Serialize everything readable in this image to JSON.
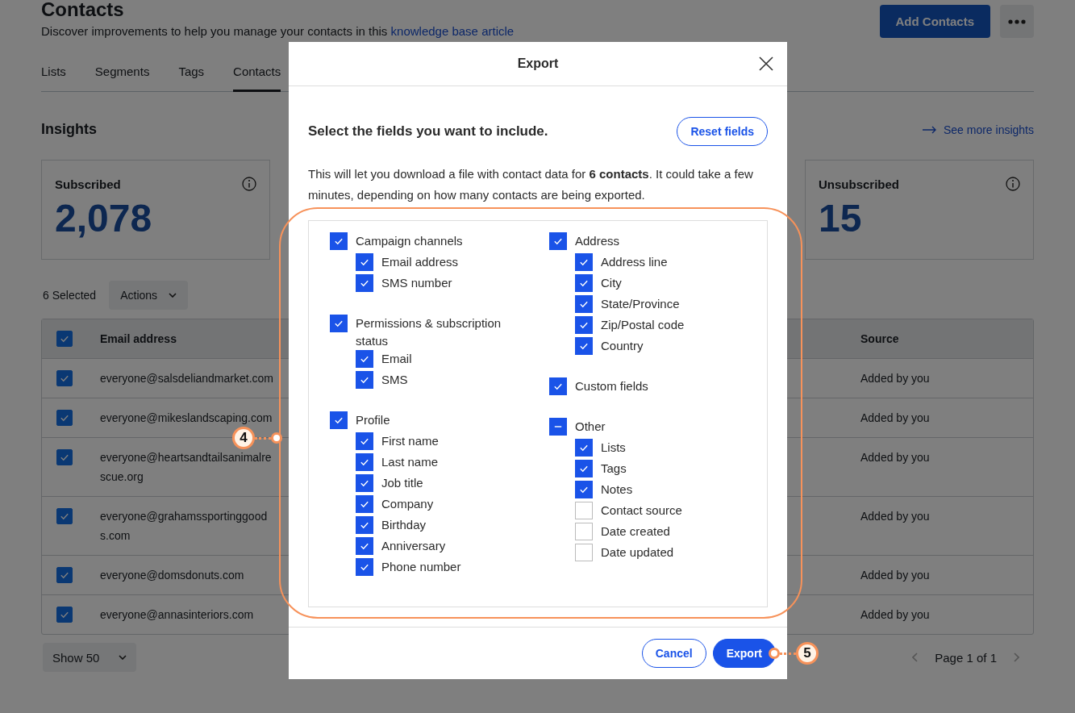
{
  "page": {
    "title": "Contacts",
    "description": "Discover improvements to help you manage your contacts in this ",
    "description_link": "knowledge base article",
    "add_button": "Add Contacts",
    "tabs": [
      {
        "label": "Lists",
        "selected": false
      },
      {
        "label": "Segments",
        "selected": false
      },
      {
        "label": "Tags",
        "selected": false
      },
      {
        "label": "Contacts",
        "selected": true
      }
    ],
    "insights_title": "Insights",
    "see_more": "See more insights",
    "cards": [
      {
        "label": "Subscribed",
        "value": "2,078"
      },
      {
        "label": "Unsubscribed",
        "value": "15"
      }
    ],
    "selected_count": "6 Selected",
    "actions_button": "Actions",
    "table": {
      "header_checked": true,
      "columns": [
        "Email address",
        "Source"
      ],
      "rows": [
        {
          "checked": true,
          "email": "everyone@salsdeliandmarket.com",
          "source": "Added by you"
        },
        {
          "checked": true,
          "email": "everyone@mikeslandscaping.com",
          "source": "Added by you"
        },
        {
          "checked": true,
          "email": "everyone@heartsandtailsanimalrescue.org",
          "source": "Added by you"
        },
        {
          "checked": true,
          "email": "everyone@grahamssportinggoods.com",
          "source": "Added by you"
        },
        {
          "checked": true,
          "email": "everyone@domsdonuts.com",
          "source": "Added by you"
        },
        {
          "checked": true,
          "email": "everyone@annasinteriors.com",
          "source": "Added by you"
        }
      ]
    },
    "show_select": "Show 50",
    "pagination": "Page 1 of 1"
  },
  "modal": {
    "title": "Export",
    "heading": "Select the fields you want to include.",
    "reset_button": "Reset fields",
    "message": "This will let you download a file with contact data for **6 contacts**. It could take a few minutes, depending on how many contacts are being exported.",
    "columns": [
      {
        "groups": [
          {
            "label": "Campaign channels",
            "checked": true,
            "children": [
              {
                "label": "Email address",
                "checked": true
              },
              {
                "label": "SMS number",
                "checked": true
              }
            ]
          },
          {
            "label": "Permissions & subscription status",
            "checked": true,
            "children": [
              {
                "label": "Email",
                "checked": true
              },
              {
                "label": "SMS",
                "checked": true
              }
            ]
          },
          {
            "label": "Profile",
            "checked": true,
            "children": [
              {
                "label": "First name",
                "checked": true
              },
              {
                "label": "Last name",
                "checked": true
              },
              {
                "label": "Job title",
                "checked": true
              },
              {
                "label": "Company",
                "checked": true
              },
              {
                "label": "Birthday",
                "checked": true
              },
              {
                "label": "Anniversary",
                "checked": true
              },
              {
                "label": "Phone number",
                "checked": true
              }
            ]
          }
        ]
      },
      {
        "groups": [
          {
            "label": "Address",
            "checked": true,
            "children": [
              {
                "label": "Address line",
                "checked": true
              },
              {
                "label": "City",
                "checked": true
              },
              {
                "label": "State/Province",
                "checked": true
              },
              {
                "label": "Zip/Postal code",
                "checked": true
              },
              {
                "label": "Country",
                "checked": true
              }
            ]
          },
          {
            "label": "Custom fields",
            "checked": true
          },
          {
            "label": "Other",
            "indeterminate": true,
            "children": [
              {
                "label": "Lists",
                "checked": true
              },
              {
                "label": "Tags",
                "checked": true
              },
              {
                "label": "Notes",
                "checked": true
              },
              {
                "label": "Contact source",
                "checked": false
              },
              {
                "label": "Date created",
                "checked": false
              },
              {
                "label": "Date updated",
                "checked": false
              }
            ]
          }
        ]
      }
    ],
    "cancel_button": "Cancel",
    "export_button": "Export"
  },
  "callouts": [
    "4",
    "5"
  ]
}
